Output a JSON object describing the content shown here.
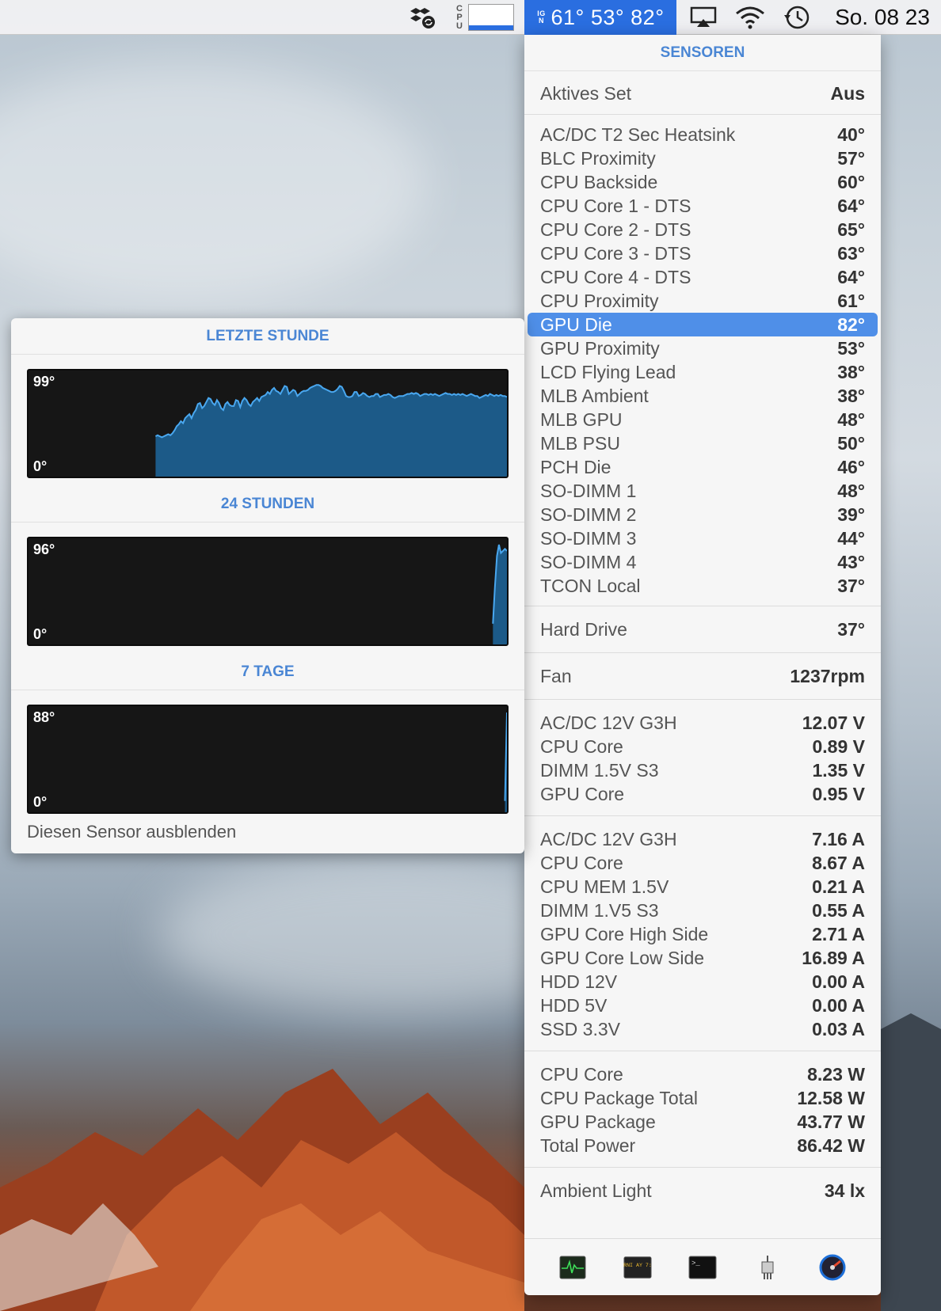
{
  "menubar": {
    "cpu_label": "CPU",
    "sensors_readout": "61° 53° 82°",
    "sensors_icon_letters": "IGN",
    "clock": "So. 08 23",
    "icons": [
      "dropbox-sync-icon",
      "cpu-graph-icon",
      "temperature-icon",
      "airplay-icon",
      "wifi-icon",
      "time-machine-icon"
    ]
  },
  "sensors": {
    "title": "SENSOREN",
    "active_set": {
      "label": "Aktives Set",
      "value": "Aus"
    },
    "temperatures": [
      {
        "label": "AC/DC T2 Sec Heatsink",
        "value": "40°"
      },
      {
        "label": "BLC Proximity",
        "value": "57°"
      },
      {
        "label": "CPU Backside",
        "value": "60°"
      },
      {
        "label": "CPU Core 1 - DTS",
        "value": "64°"
      },
      {
        "label": "CPU Core 2 - DTS",
        "value": "65°"
      },
      {
        "label": "CPU Core 3 - DTS",
        "value": "63°"
      },
      {
        "label": "CPU Core 4 - DTS",
        "value": "64°"
      },
      {
        "label": "CPU Proximity",
        "value": "61°"
      },
      {
        "label": "GPU Die",
        "value": "82°",
        "selected": true
      },
      {
        "label": "GPU Proximity",
        "value": "53°"
      },
      {
        "label": "LCD Flying Lead",
        "value": "38°"
      },
      {
        "label": "MLB Ambient",
        "value": "38°"
      },
      {
        "label": "MLB GPU",
        "value": "48°"
      },
      {
        "label": "MLB PSU",
        "value": "50°"
      },
      {
        "label": "PCH Die",
        "value": "46°"
      },
      {
        "label": "SO-DIMM 1",
        "value": "48°"
      },
      {
        "label": "SO-DIMM 2",
        "value": "39°"
      },
      {
        "label": "SO-DIMM 3",
        "value": "44°"
      },
      {
        "label": "SO-DIMM 4",
        "value": "43°"
      },
      {
        "label": "TCON Local",
        "value": "37°"
      }
    ],
    "drives": [
      {
        "label": "Hard Drive",
        "value": "37°"
      }
    ],
    "fans": [
      {
        "label": "Fan",
        "value": "1237rpm"
      }
    ],
    "voltages": [
      {
        "label": "AC/DC 12V G3H",
        "value": "12.07 V"
      },
      {
        "label": "CPU Core",
        "value": "0.89 V"
      },
      {
        "label": "DIMM 1.5V S3",
        "value": "1.35 V"
      },
      {
        "label": "GPU Core",
        "value": "0.95 V"
      }
    ],
    "currents": [
      {
        "label": "AC/DC 12V G3H",
        "value": "7.16 A"
      },
      {
        "label": "CPU Core",
        "value": "8.67 A"
      },
      {
        "label": "CPU MEM 1.5V",
        "value": "0.21 A"
      },
      {
        "label": "DIMM 1.V5 S3",
        "value": "0.55 A"
      },
      {
        "label": "GPU Core High Side",
        "value": "2.71 A"
      },
      {
        "label": "GPU Core Low Side",
        "value": "16.89 A"
      },
      {
        "label": "HDD 12V",
        "value": "0.00 A"
      },
      {
        "label": "HDD 5V",
        "value": "0.00 A"
      },
      {
        "label": "SSD 3.3V",
        "value": "0.03 A"
      }
    ],
    "power": [
      {
        "label": "CPU Core",
        "value": "8.23 W"
      },
      {
        "label": "CPU Package Total",
        "value": "12.58 W"
      },
      {
        "label": "GPU Package",
        "value": "43.77 W"
      },
      {
        "label": "Total Power",
        "value": "86.42 W"
      }
    ],
    "light": [
      {
        "label": "Ambient Light",
        "value": "34 lx"
      }
    ],
    "footer_icons": [
      "activity-monitor-icon",
      "console-icon",
      "terminal-icon",
      "system-information-icon",
      "disk-utility-icon"
    ],
    "footer_icon_text": {
      "console": "WARNI AY 7:36",
      "terminal": ">_"
    }
  },
  "history": {
    "sections": [
      {
        "title": "LETZTE STUNDE",
        "max": "99°",
        "min": "0°",
        "scale": 99,
        "series": [
          null,
          null,
          null,
          null,
          null,
          null,
          null,
          null,
          null,
          null,
          null,
          null,
          null,
          null,
          null,
          null,
          null,
          null,
          null,
          null,
          null,
          null,
          null,
          null,
          null,
          null,
          null,
          null,
          null,
          null,
          null,
          null,
          null,
          null,
          null,
          null,
          null,
          null,
          null,
          null,
          null,
          null,
          null,
          null,
          null,
          null,
          null,
          null,
          null,
          null,
          null,
          null,
          null,
          null,
          null,
          null,
          null,
          null,
          null,
          null,
          40,
          41,
          40,
          39,
          40,
          41,
          42,
          41,
          43,
          46,
          50,
          52,
          55,
          53,
          58,
          60,
          62,
          58,
          63,
          66,
          72,
          73,
          68,
          70,
          74,
          78,
          77,
          73,
          71,
          76,
          73,
          68,
          66,
          72,
          74,
          71,
          70,
          70,
          76,
          75,
          69,
          75,
          78,
          76,
          72,
          70,
          74,
          76,
          78,
          75,
          79,
          80,
          81,
          84,
          82,
          86,
          88,
          85,
          84,
          82,
          86,
          90,
          89,
          82,
          84,
          86,
          85,
          80,
          82,
          84,
          85,
          85,
          86,
          88,
          89,
          90,
          91,
          91,
          90,
          88,
          87,
          86,
          85,
          84,
          84,
          85,
          87,
          90,
          89,
          85,
          80,
          79,
          79,
          80,
          84,
          84,
          80,
          81,
          83,
          82,
          80,
          79,
          80,
          80,
          82,
          82,
          79,
          80,
          81,
          81,
          82,
          81,
          79,
          78,
          79,
          80,
          80,
          80,
          81,
          82,
          82,
          83,
          82,
          83,
          82,
          80,
          81,
          82,
          82,
          81,
          82,
          81,
          82,
          81,
          80,
          81,
          82,
          83,
          82,
          82,
          81,
          82,
          81,
          82,
          81,
          82,
          81,
          80,
          81,
          82,
          81,
          80,
          80,
          78,
          79,
          80,
          81,
          80,
          82,
          81,
          80,
          81,
          80,
          81,
          80,
          80,
          79
        ]
      },
      {
        "title": "24 STUNDEN",
        "max": "96°",
        "min": "0°",
        "scale": 96,
        "series": [
          null,
          null,
          null,
          null,
          null,
          null,
          null,
          null,
          null,
          null,
          null,
          null,
          null,
          null,
          null,
          null,
          null,
          null,
          null,
          null,
          null,
          null,
          null,
          null,
          null,
          null,
          null,
          null,
          null,
          null,
          null,
          null,
          null,
          null,
          null,
          null,
          null,
          null,
          null,
          null,
          null,
          null,
          null,
          null,
          null,
          null,
          null,
          null,
          null,
          null,
          null,
          null,
          null,
          null,
          null,
          null,
          null,
          null,
          null,
          null,
          null,
          null,
          null,
          null,
          null,
          null,
          null,
          null,
          null,
          null,
          null,
          null,
          null,
          null,
          null,
          null,
          null,
          null,
          null,
          null,
          null,
          null,
          null,
          null,
          null,
          null,
          null,
          null,
          null,
          null,
          null,
          null,
          null,
          null,
          null,
          null,
          null,
          null,
          null,
          null,
          null,
          null,
          null,
          null,
          null,
          null,
          null,
          null,
          null,
          null,
          null,
          null,
          null,
          null,
          null,
          null,
          null,
          null,
          null,
          null,
          null,
          null,
          null,
          null,
          null,
          null,
          null,
          null,
          null,
          null,
          null,
          null,
          null,
          null,
          null,
          null,
          null,
          null,
          null,
          null,
          null,
          null,
          null,
          null,
          null,
          null,
          null,
          null,
          null,
          null,
          null,
          null,
          null,
          null,
          null,
          null,
          null,
          null,
          null,
          null,
          null,
          null,
          null,
          null,
          null,
          null,
          null,
          null,
          null,
          null,
          null,
          null,
          null,
          null,
          null,
          null,
          null,
          null,
          null,
          null,
          null,
          null,
          null,
          null,
          null,
          null,
          null,
          null,
          null,
          null,
          null,
          null,
          null,
          null,
          null,
          null,
          null,
          null,
          null,
          null,
          null,
          null,
          null,
          null,
          null,
          null,
          null,
          null,
          null,
          null,
          null,
          null,
          null,
          null,
          null,
          null,
          null,
          null,
          null,
          null,
          null,
          null,
          null,
          null,
          null,
          null,
          null,
          null,
          null,
          null,
          null,
          null,
          20,
          55,
          85,
          96,
          88,
          90,
          92,
          90
        ]
      },
      {
        "title": "7 TAGE",
        "max": "88°",
        "min": "0°",
        "scale": 88,
        "series": [
          null,
          null,
          null,
          null,
          null,
          null,
          null,
          null,
          null,
          null,
          null,
          null,
          null,
          null,
          null,
          null,
          null,
          null,
          null,
          null,
          null,
          null,
          null,
          null,
          null,
          null,
          null,
          null,
          null,
          null,
          null,
          null,
          null,
          null,
          null,
          null,
          null,
          null,
          null,
          null,
          null,
          null,
          null,
          null,
          null,
          null,
          null,
          null,
          null,
          null,
          null,
          null,
          null,
          null,
          null,
          null,
          null,
          null,
          null,
          null,
          null,
          null,
          null,
          null,
          null,
          null,
          null,
          null,
          null,
          null,
          null,
          null,
          null,
          null,
          null,
          null,
          null,
          null,
          null,
          null,
          null,
          null,
          null,
          null,
          null,
          null,
          null,
          null,
          null,
          null,
          null,
          null,
          null,
          null,
          null,
          null,
          null,
          null,
          null,
          null,
          null,
          null,
          null,
          null,
          null,
          null,
          null,
          null,
          null,
          null,
          null,
          null,
          null,
          null,
          null,
          null,
          null,
          null,
          null,
          null,
          null,
          null,
          null,
          null,
          null,
          null,
          null,
          null,
          null,
          null,
          null,
          null,
          null,
          null,
          null,
          null,
          null,
          null,
          null,
          null,
          null,
          null,
          null,
          null,
          null,
          null,
          null,
          null,
          null,
          null,
          null,
          null,
          null,
          null,
          null,
          null,
          null,
          null,
          null,
          null,
          null,
          null,
          null,
          null,
          null,
          null,
          null,
          null,
          null,
          null,
          null,
          null,
          null,
          null,
          null,
          null,
          null,
          null,
          null,
          null,
          null,
          null,
          null,
          null,
          null,
          null,
          null,
          null,
          null,
          null,
          null,
          null,
          null,
          null,
          null,
          null,
          null,
          null,
          null,
          null,
          null,
          null,
          null,
          null,
          null,
          null,
          null,
          null,
          null,
          null,
          null,
          null,
          null,
          null,
          null,
          null,
          null,
          null,
          null,
          null,
          null,
          null,
          null,
          null,
          null,
          null,
          null,
          null,
          null,
          null,
          null,
          null,
          null,
          null,
          null,
          null,
          null,
          10,
          88
        ]
      }
    ],
    "hide_sensor": "Diesen Sensor ausblenden"
  }
}
